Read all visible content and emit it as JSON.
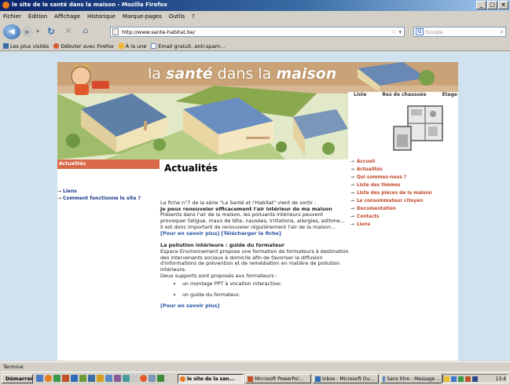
{
  "window": {
    "title": "le site de la santé dans la maison - Mozilla Firefox",
    "buttons": [
      "_",
      "□",
      "×"
    ]
  },
  "menu": [
    "Fichier",
    "Édition",
    "Affichage",
    "Historique",
    "Marque-pages",
    "Outils",
    "?"
  ],
  "url": "http://www.sante-habitat.be/",
  "search_placeholder": "Google",
  "bookmarks": [
    {
      "label": "Les plus visités",
      "color": "#3a6ea5"
    },
    {
      "label": "Débuter avec Firefox",
      "color": "#d9562a"
    },
    {
      "label": "À la une",
      "color": "#f2b632"
    },
    {
      "label": "Email gratuit, anti-spam...",
      "color": "#6a8bc0"
    }
  ],
  "site": {
    "banner_title_a": "la",
    "banner_title_b": "santé",
    "banner_title_c": "dans la",
    "banner_title_d": "maison",
    "plan_labels": [
      "Liste",
      "Rez de chaussée",
      "Etage"
    ],
    "left_header": "Actualités",
    "left_links": [
      "Liens",
      "Comment fonctionne le site ?"
    ],
    "page_title": "Actualités",
    "intro": "La fiche n°7 de la série \"La Santé et l'Habitat\" vient de sortir :",
    "intro_bold": "Je peux renouveler efficacement l'air intérieur de ma maison",
    "intro_text": "Présents dans l'air de la maison, les polluants intérieurs peuvent provoquer fatigue, maux de tête, nausées, irritations, allergies, asthme... Il est donc important de renouveler régulièrement l'air de la maison...",
    "link_more": "[Pour en savoir plus]",
    "link_download": "[Télécharger la fiche]",
    "section2_title": "La pollution intérieure : guide du formateur",
    "section2_text": "Espace Environnement propose une formation de formateurs à destination des intervenants sociaux à domicile afin de favoriser la diffusion d'informations de prévention et de remédiation en matière de pollution intérieure.",
    "section2_text2": "Deux supports sont proposés aux formateurs :",
    "bullets": [
      "un montage PPT à vocation interactive;",
      "un guide du formateur."
    ],
    "link_more2": "[Pour en savoir plus]",
    "right_nav": [
      "Accueil",
      "Actualités",
      "Qui sommes-nous ?",
      "Liste des thèmes",
      "Liste des pièces de la maison",
      "Le consommateur citoyen",
      "Documentation",
      "Contacts",
      "Liens"
    ]
  },
  "status": "Terminé",
  "taskbar": {
    "start": "Démarrer",
    "tasks": [
      {
        "label": "le site de la san...",
        "active": true,
        "color": "#e87a1e"
      },
      {
        "label": "Microsoft PowerPoi...",
        "active": false,
        "color": "#c2512a"
      },
      {
        "label": "Inbox - Microsoft Ou...",
        "active": false,
        "color": "#2e6bb8"
      },
      {
        "label": "Sans titre - Message ...",
        "active": false,
        "color": "#5a8ac6"
      }
    ],
    "clock": "13:4"
  }
}
